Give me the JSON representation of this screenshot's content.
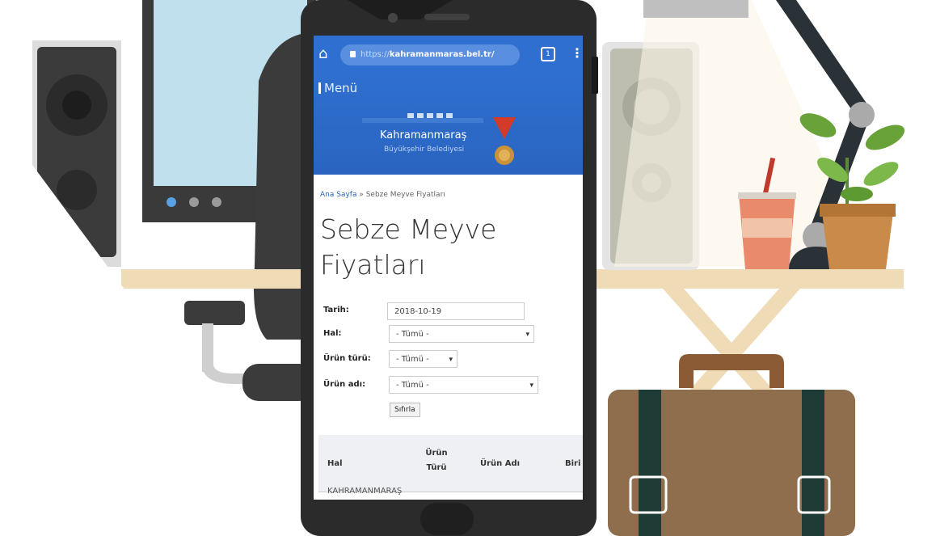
{
  "browser": {
    "url_protocol": "https://",
    "url_host": "kahramanmaras.bel.tr/",
    "tab_count": "1",
    "menu_glyph": "⋮",
    "home_glyph": "⌂"
  },
  "site": {
    "menu_label": "Menü",
    "org_name": "Kahramanmaraş",
    "org_sub": "Büyükşehir Belediyesi"
  },
  "breadcrumb": {
    "home": "Ana Sayfa",
    "separator": " » ",
    "current": "Sebze Meyve Fiyatları"
  },
  "page": {
    "title": "Sebze Meyve Fiyatları"
  },
  "filters": {
    "date_label": "Tarih:",
    "date_value": "2018-10-19",
    "hal_label": "Hal:",
    "hal_value": "- Tümü -",
    "type_label": "Ürün türü:",
    "type_value": "- Tümü -",
    "name_label": "Ürün adı:",
    "name_value": "- Tümü -",
    "reset_label": "Sıfırla"
  },
  "table": {
    "columns": [
      "Hal",
      "Ürün Türü",
      "Ürün Adı",
      "Biri"
    ],
    "first_row_hal": "KAHRAMANMARAŞ"
  },
  "colors": {
    "brand_blue": "#2f6fcf",
    "desk_wood": "#efdcb7",
    "case_brown": "#8e6e4c"
  }
}
